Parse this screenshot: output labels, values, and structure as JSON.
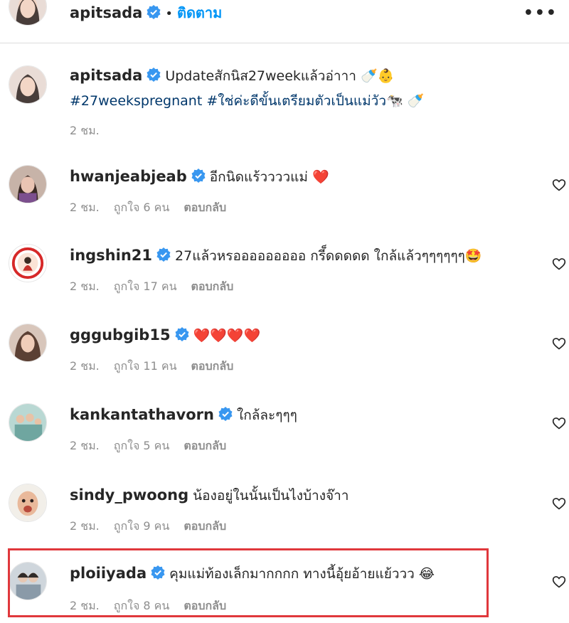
{
  "header": {
    "username": "apitsada",
    "follow_label": "ติดตาม",
    "more_label": "•••"
  },
  "caption": {
    "username": "apitsada",
    "text": "Updateสักนิส27weekแล้วอ่าาา 🍼👶",
    "hashtags": "#27weekspregnant #ใช่ค่ะดีขั้นเตรียมตัวเป็นแม่วัว🐄 🍼",
    "time": "2 ชม."
  },
  "comments": [
    {
      "username": "hwanjeabjeab",
      "verified": true,
      "text": "อีกนิดแร้ววววแม่ ❤️",
      "time": "2 ชม.",
      "likes": "ถูกใจ 6 คน",
      "reply": "ตอบกลับ"
    },
    {
      "username": "ingshin21",
      "verified": true,
      "text": "27แล้วหรอออออออออ กรี็ดดดดด ใกล้แล้วๆๆๆๆๆๆ🤩",
      "time": "2 ชม.",
      "likes": "ถูกใจ 17 คน",
      "reply": "ตอบกลับ"
    },
    {
      "username": "gggubgib15",
      "verified": true,
      "text": "❤️❤️❤️❤️",
      "time": "2 ชม.",
      "likes": "ถูกใจ 11 คน",
      "reply": "ตอบกลับ"
    },
    {
      "username": "kankantathavorn",
      "verified": true,
      "text": "ใกล้ละๆๆๆ",
      "time": "2 ชม.",
      "likes": "ถูกใจ 5 คน",
      "reply": "ตอบกลับ"
    },
    {
      "username": "sindy_pwoong",
      "verified": false,
      "text": "น้องอยู่ในนั้นเป็นไงบ้างจ๊าา",
      "time": "2 ชม.",
      "likes": "ถูกใจ 9 คน",
      "reply": "ตอบกลับ"
    },
    {
      "username": "ploiiyada",
      "verified": true,
      "text": "คุมแม่ท้องเล็กมากกกก ทางนี้อุ้ยอ้ายแย้ววว 😂",
      "time": "2 ชม.",
      "likes": "ถูกใจ 8 คน",
      "reply": "ตอบกลับ"
    }
  ],
  "colors": {
    "accent": "#0095f6",
    "verified": "#3897f0",
    "highlight": "#e0383c",
    "meta": "#8e8e8e"
  }
}
